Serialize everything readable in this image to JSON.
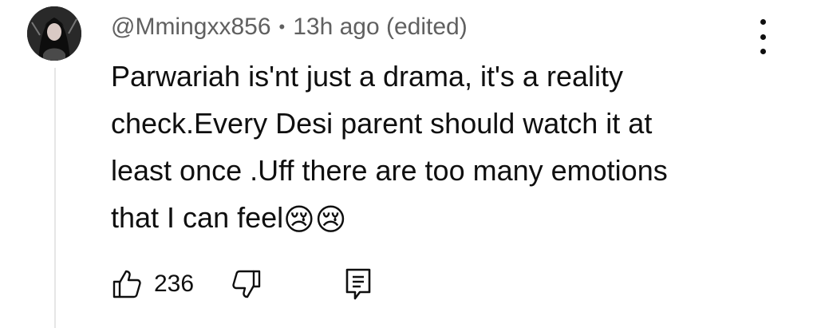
{
  "comment": {
    "author": "@Mmingxx856",
    "separator": "•",
    "time": "13h ago (edited)",
    "lines": [
      "Parwariah is'nt just a drama, it's a reality",
      "check.Every Desi parent should watch it at",
      "least once .Uff there are too many emotions",
      "that I can feel"
    ],
    "emojis": [
      "😢",
      "😢"
    ],
    "likes": "236"
  },
  "icons": {
    "avatar": "user-avatar",
    "menu": "more-vert-icon",
    "like": "thumbs-up-icon",
    "dislike": "thumbs-down-icon",
    "reply": "reply-comment-icon"
  },
  "colors": {
    "text": "#0f0f0f",
    "meta": "#606060",
    "thread_line": "#e6e6e6"
  }
}
